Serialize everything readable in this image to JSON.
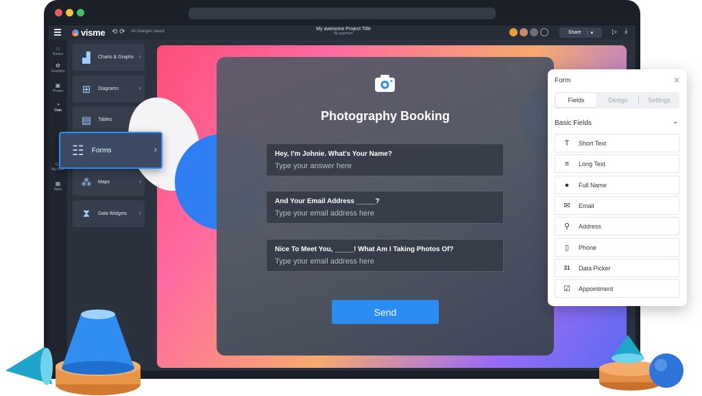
{
  "app": {
    "brand": "visme",
    "saved_status": "All changes saved",
    "project_title": "My awesome Project Title",
    "project_author": "By paymon",
    "share_label": "Share"
  },
  "rail": [
    {
      "label": "Basics",
      "icon": "basics-icon"
    },
    {
      "label": "Graphics",
      "icon": "graphics-icon"
    },
    {
      "label": "Photos",
      "icon": "photos-icon"
    },
    {
      "label": "Data",
      "icon": "data-icon"
    },
    {
      "label": "My Files",
      "icon": "folder-icon"
    },
    {
      "label": "Apps",
      "icon": "apps-icon"
    }
  ],
  "categories": [
    {
      "label": "Charts & Graphs"
    },
    {
      "label": "Diagrams"
    },
    {
      "label": "Tables"
    },
    {
      "label": "Forms"
    },
    {
      "label": "Maps"
    },
    {
      "label": "Data Widgets"
    }
  ],
  "form": {
    "title": "Photography Booking",
    "fields": [
      {
        "question": "Hey, I'm Johnie. What's Your Name?",
        "placeholder": "Type your answer here"
      },
      {
        "question": "And Your Email Address _____?",
        "placeholder": "Type your email address here"
      },
      {
        "question": "Nice To Meet You, _____! What Am I Taking Photos Of?",
        "placeholder": "Type your email address here"
      }
    ],
    "submit_label": "Send"
  },
  "side_panel": {
    "title": "Form",
    "tabs": [
      "Fields",
      "Design",
      "Settings"
    ],
    "section_title": "Basic Fields",
    "items": [
      {
        "label": "Short Text",
        "icon": "text-t-icon"
      },
      {
        "label": "Long Text",
        "icon": "long-text-icon"
      },
      {
        "label": "Full Name",
        "icon": "person-icon"
      },
      {
        "label": "Email",
        "icon": "envelope-icon"
      },
      {
        "label": "Address",
        "icon": "map-pin-icon"
      },
      {
        "label": "Phone",
        "icon": "phone-icon"
      },
      {
        "label": "Data Picker",
        "icon": "calendar-icon",
        "icon_text": "31"
      },
      {
        "label": "Appointment",
        "icon": "calendar-check-icon"
      }
    ]
  },
  "colors": {
    "accent": "#2b8cf2",
    "selection_border": "#2f8df5"
  }
}
